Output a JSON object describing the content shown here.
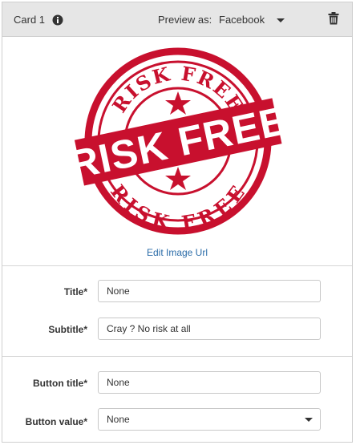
{
  "header": {
    "card_label": "Card 1",
    "info_icon": "info-circle-icon",
    "preview_label": "Preview as:",
    "preview_value": "Facebook",
    "delete_icon": "trash-icon"
  },
  "image": {
    "stamp_top_text": "RISK FREE",
    "stamp_main_text": "RISK FREE",
    "stamp_bottom_text": "RISK FREE",
    "stamp_color": "#c8102e",
    "edit_link": "Edit Image Url"
  },
  "form": {
    "title_label": "Title*",
    "title_value": "None",
    "subtitle_label": "Subtitle*",
    "subtitle_value": "Cray ? No risk at all",
    "button_title_label": "Button title*",
    "button_title_value": "None",
    "button_value_label": "Button value*",
    "button_value_selected": "None"
  },
  "colors": {
    "header_bg": "#e6e6e6",
    "link": "#2b6ca8",
    "border": "#cfcfcf"
  }
}
